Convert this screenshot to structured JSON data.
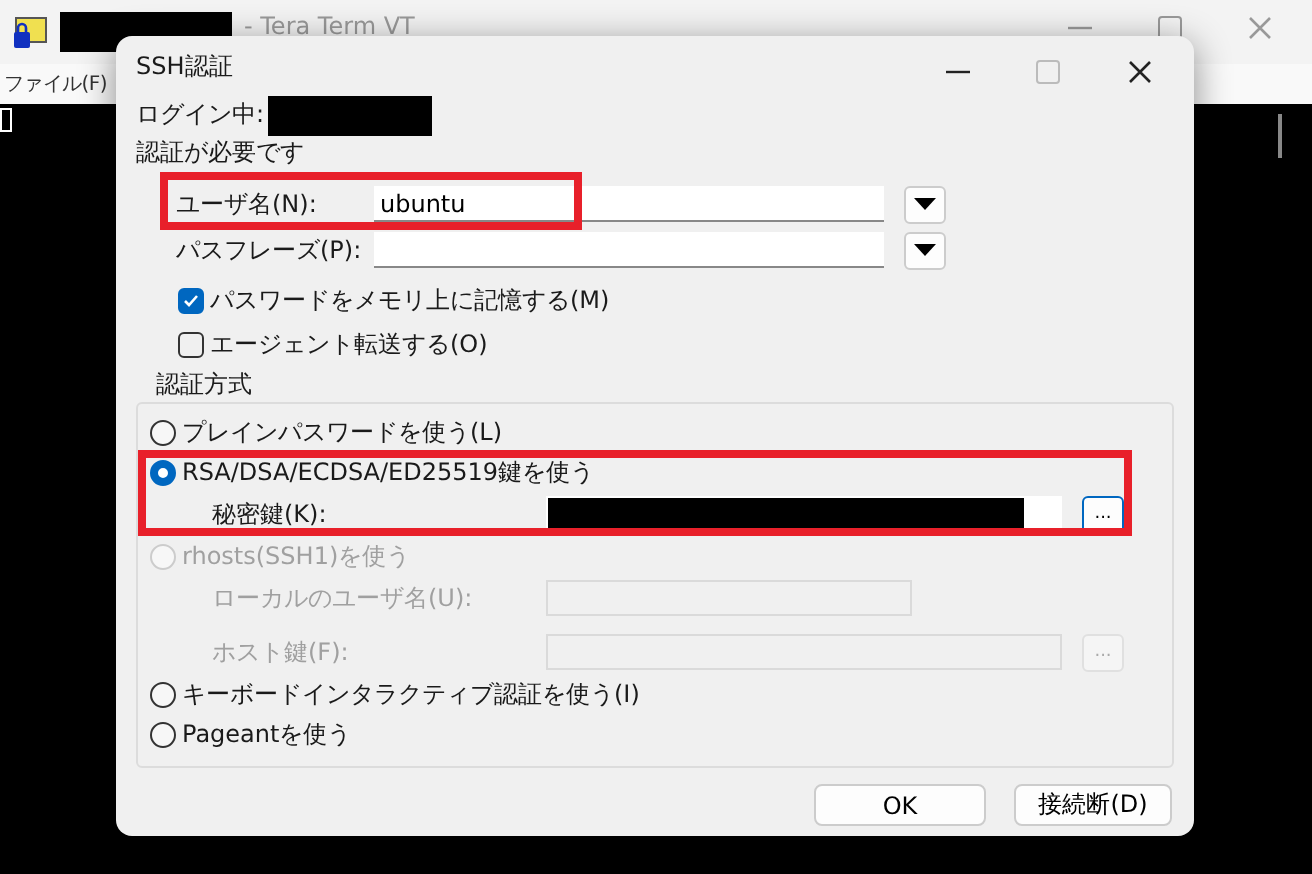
{
  "background_window": {
    "title_redacted": true,
    "title": "- Tera Term VT",
    "menu": [
      "ファイル(F)"
    ]
  },
  "dialog": {
    "title": "SSH認証",
    "login_label": "ログイン中:",
    "login_redacted": true,
    "message": "認証が必要です",
    "fields": [
      {
        "label": "ユーザ名(N):",
        "value": "ubuntu",
        "highlighted": true
      },
      {
        "label": "パスフレーズ(P):",
        "highlighted": false
      }
    ],
    "checkboxes": [
      {
        "label": "パスワードをメモリ上に記憶する(M)",
        "checked": true
      },
      {
        "label": "エージェント転送する(O)",
        "checked": false
      }
    ],
    "auth_group": {
      "title": "認証方式",
      "options": [
        {
          "label": "プレインパスワードを使う(L)",
          "selected": false,
          "disabled": false,
          "highlighted": false
        },
        {
          "label": "RSA/DSA/ECDSA/ED25519鍵を使う",
          "selected": true,
          "disabled": false,
          "highlighted": true,
          "fields": [
            {
              "label": "秘密鍵(K):",
              "redacted": true,
              "browse": "..."
            }
          ]
        },
        {
          "label": "rhosts(SSH1)を使う",
          "selected": false,
          "disabled": true,
          "highlighted": false,
          "fields": [
            {
              "label": "ローカルのユーザ名(U):",
              "redacted": false
            },
            {
              "label": "ホスト鍵(F):",
              "redacted": false,
              "browse": "..."
            }
          ]
        },
        {
          "label": "キーボードインタラクティブ認証を使う(I)",
          "selected": false,
          "disabled": false,
          "highlighted": false
        },
        {
          "label": "Pageantを使う",
          "selected": false,
          "disabled": false,
          "highlighted": false
        }
      ]
    },
    "buttons": [
      "OK",
      "接続断(D)"
    ]
  }
}
